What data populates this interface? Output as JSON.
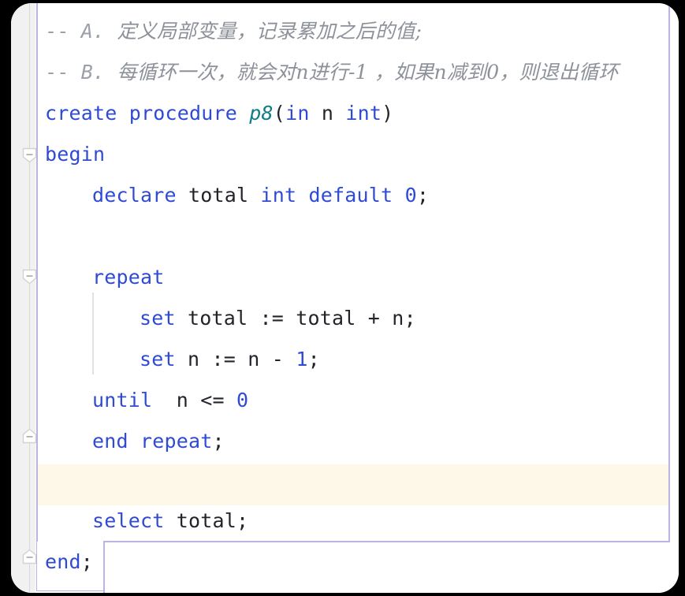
{
  "editor": {
    "language": "SQL",
    "current_line_index": 11,
    "colors": {
      "keyword": "#2f4bd4",
      "identifier": "#22242a",
      "number": "#2f4bd4",
      "function": "#0f7d86",
      "comment": "#9ca0a8",
      "current_line_highlight": "#fdf8e7",
      "block_guide": "#b9b4e4",
      "gutter_background": "#f1f1f1",
      "editor_background": "#ffffff"
    },
    "gutter": {
      "fold_markers": [
        {
          "name": "fold-marker-begin",
          "state": "expanded",
          "direction": "down",
          "line": "begin"
        },
        {
          "name": "fold-marker-repeat",
          "state": "expanded",
          "direction": "down",
          "line": "repeat"
        },
        {
          "name": "fold-marker-end-repeat",
          "state": "expanded",
          "direction": "up",
          "line": "end repeat;"
        },
        {
          "name": "fold-marker-end",
          "state": "expanded",
          "direction": "up",
          "line": "end;"
        }
      ]
    },
    "code": {
      "line_01_comment_a": {
        "dash": "-- ",
        "label": "A. ",
        "text": "定义局部变量，记录累加之后的值;"
      },
      "line_02_comment_b": {
        "dash": "-- ",
        "label": "B. ",
        "text": "每循环一次，就会对n进行-1 ，如果n减到0，则退出循环"
      },
      "line_03_create": {
        "keyword": "create procedure ",
        "name": "p8",
        "open_paren": "(",
        "param_mode": "in",
        "param_name": " n ",
        "param_type": "int",
        "close_paren": ")"
      },
      "line_04_begin": {
        "keyword": "begin"
      },
      "line_05_declare": {
        "keyword": "declare ",
        "variable": "total",
        "type": " int",
        "default_keyword": " default ",
        "value": "0",
        "terminator": ";"
      },
      "line_07_repeat": {
        "keyword": "repeat"
      },
      "line_08_set_total": {
        "keyword": "set ",
        "target": "total ",
        "assign": ":= ",
        "expression": "total + n",
        "terminator": ";"
      },
      "line_09_set_n": {
        "keyword": "set ",
        "target": "n ",
        "assign": ":= ",
        "expr_left": "n - ",
        "expr_number": "1",
        "terminator": ";"
      },
      "line_10_until": {
        "keyword": "until",
        "condition": "  n <= ",
        "value": "0"
      },
      "line_11_end_repeat": {
        "keyword": "end repeat",
        "terminator": ";"
      },
      "line_13_select": {
        "keyword": "select ",
        "target": "total",
        "terminator": ";"
      },
      "line_14_end": {
        "keyword": "end",
        "terminator": ";"
      }
    }
  }
}
